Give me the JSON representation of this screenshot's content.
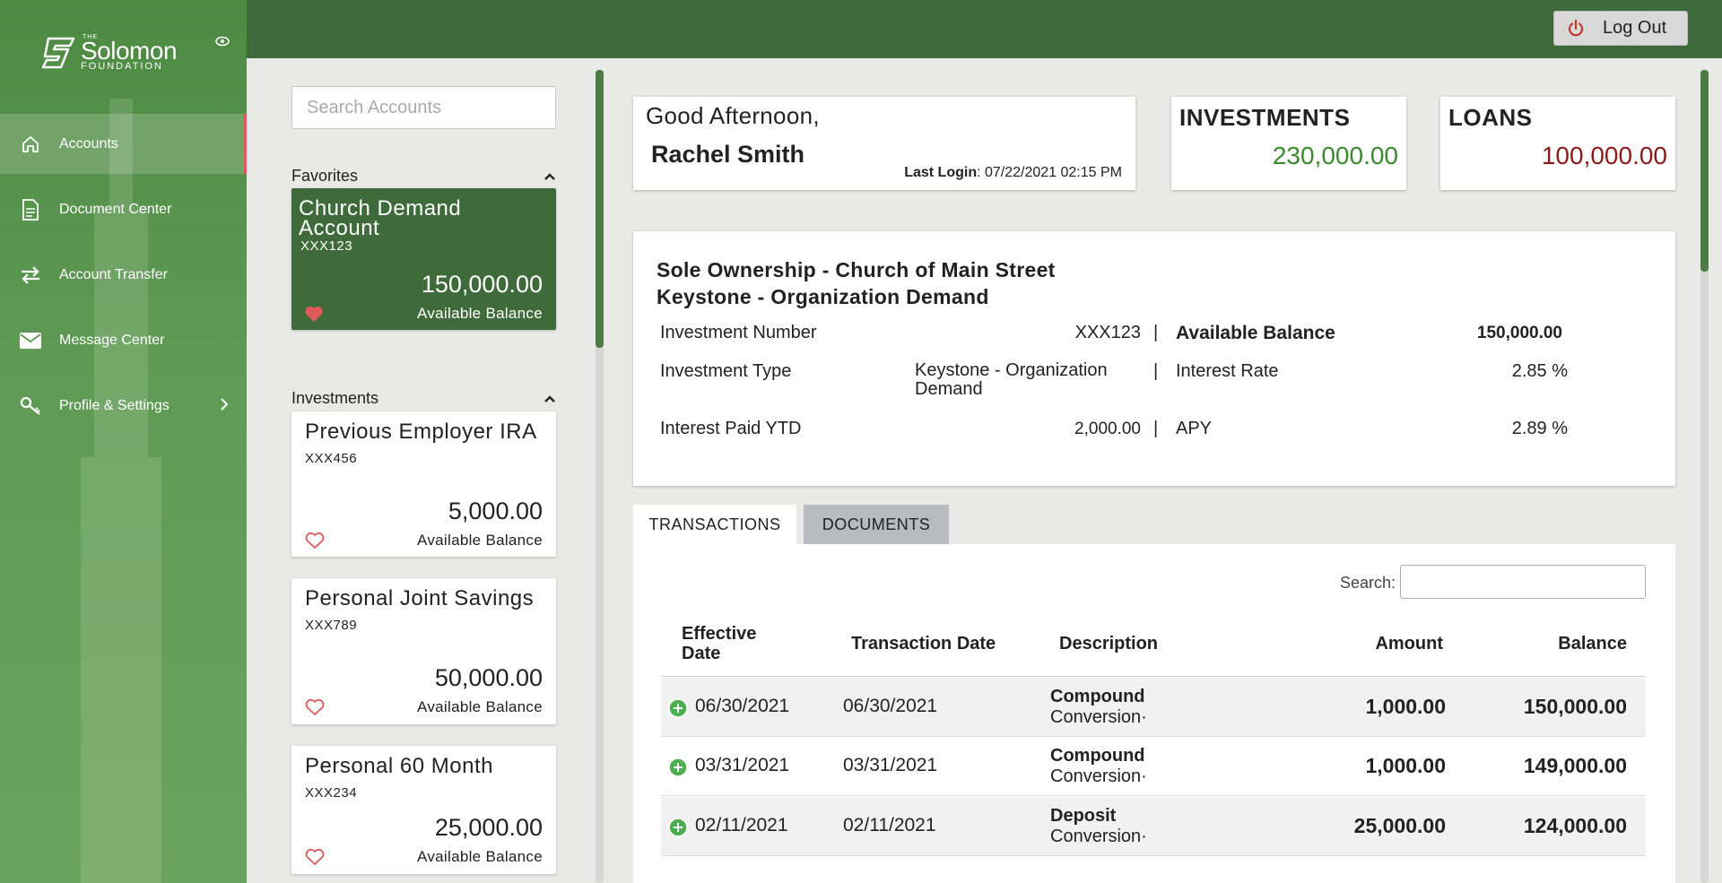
{
  "brand": {
    "the": "THE",
    "name": "Solomon",
    "sub": "FOUNDATION"
  },
  "sidebar": {
    "items": [
      {
        "label": "Accounts",
        "icon": "home-icon"
      },
      {
        "label": "Document Center",
        "icon": "document-icon"
      },
      {
        "label": "Account Transfer",
        "icon": "transfer-icon"
      },
      {
        "label": "Message Center",
        "icon": "envelope-icon"
      },
      {
        "label": "Profile & Settings",
        "icon": "key-icon"
      }
    ]
  },
  "header": {
    "logout_label": "Log Out"
  },
  "search": {
    "placeholder": "Search Accounts"
  },
  "favorites": {
    "title": "Favorites",
    "accounts": [
      {
        "name": "Church Demand Account",
        "number": "XXX123",
        "balance": "150,000.00",
        "balance_label": "Available Balance",
        "favorite": true
      }
    ]
  },
  "investments": {
    "title": "Investments",
    "accounts": [
      {
        "name": "Previous Employer IRA",
        "number": "XXX456",
        "balance": "5,000.00",
        "balance_label": "Available Balance",
        "favorite": false
      },
      {
        "name": "Personal Joint Savings",
        "number": "XXX789",
        "balance": "50,000.00",
        "balance_label": "Available Balance",
        "favorite": false
      },
      {
        "name": "Personal 60 Month",
        "number": "XXX234",
        "balance": "25,000.00",
        "balance_label": "Available Balance",
        "favorite": false
      }
    ]
  },
  "greeting": {
    "hello": "Good Afternoon,",
    "name": "Rachel Smith",
    "last_login_label": "Last Login",
    "last_login_value": ": 07/22/2021 02:15 PM"
  },
  "summary": {
    "investments": {
      "title": "INVESTMENTS",
      "value": "230,000.00"
    },
    "loans": {
      "title": "LOANS",
      "value": "100,000.00"
    }
  },
  "detail": {
    "title_line1_prefix": "Sole Ownership - ",
    "title_line1_bold": "Church of Main Street",
    "title_line2": "Keystone - Organization Demand",
    "rows": [
      {
        "label": "Investment Number",
        "value": "XXX123",
        "right_label": "Available Balance",
        "right_value": "150,000.00"
      },
      {
        "label": "Investment Type",
        "value": "Keystone - Organization Demand",
        "right_label": "Interest Rate",
        "right_value": "2.85 %"
      },
      {
        "label": "Interest Paid YTD",
        "value": "2,000.00",
        "right_label": "APY",
        "right_value": "2.89 %"
      }
    ],
    "separator": "|"
  },
  "tabs": [
    {
      "label": "TRANSACTIONS",
      "active": true
    },
    {
      "label": "DOCUMENTS",
      "active": false
    }
  ],
  "transactions": {
    "search_label": "Search:",
    "search_value": "",
    "columns": [
      "Effective Date",
      "Transaction Date",
      "Description",
      "Amount",
      "Balance"
    ],
    "rows": [
      {
        "effective": "06/30/2021",
        "transaction": "06/30/2021",
        "desc_title": "Compound",
        "desc_sub": "Conversion·",
        "amount": "1,000.00",
        "balance": "150,000.00"
      },
      {
        "effective": "03/31/2021",
        "transaction": "03/31/2021",
        "desc_title": "Compound",
        "desc_sub": "Conversion·",
        "amount": "1,000.00",
        "balance": "149,000.00"
      },
      {
        "effective": "02/11/2021",
        "transaction": "02/11/2021",
        "desc_title": "Deposit",
        "desc_sub": "Conversion·",
        "amount": "25,000.00",
        "balance": "124,000.00"
      }
    ]
  },
  "colors": {
    "brand_green": "#3e6a3a",
    "sidebar_green": "#5f9a54",
    "positive": "#3a8a2e",
    "negative": "#8b1a1a",
    "heart": "#e05a5a"
  }
}
